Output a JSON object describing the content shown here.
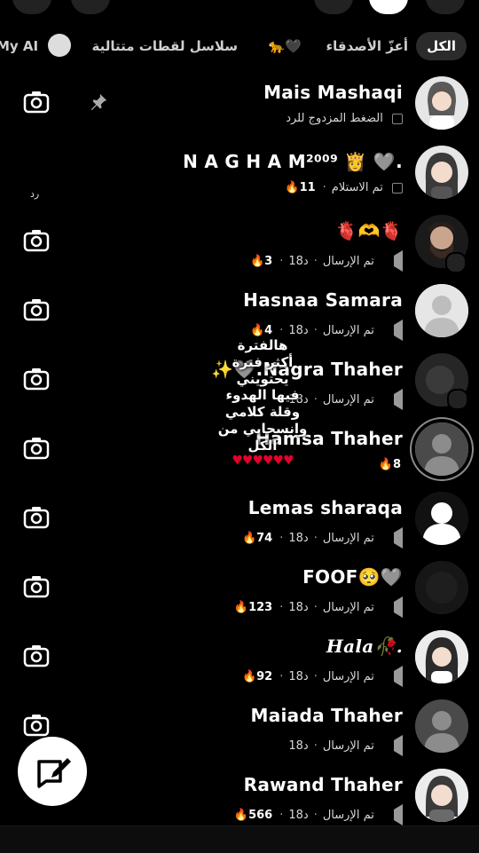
{
  "tabs": [
    {
      "label": "الكل",
      "active": true
    },
    {
      "label": "أعزّ الأصدقاء",
      "active": false
    },
    {
      "label": "🐆🖤",
      "active": false
    },
    {
      "label": "سلاسل لقطات متتالية",
      "active": false
    },
    {
      "label": "My AI",
      "active": false
    }
  ],
  "chats": [
    {
      "name": "Mais Mashaqi",
      "status": "الضغط المزدوج للرد",
      "status_icon": "checkbox",
      "time": "",
      "streak": "",
      "pinned": true
    },
    {
      "name": "N A G H A M²⁰⁰⁹ 👸 🩶.",
      "status": "تم الاستلام",
      "status_icon": "checkbox",
      "time": "",
      "streak": "11"
    },
    {
      "name": "🫀🫶🫀",
      "status": "تم الإرسال",
      "status_icon": "sent",
      "time": "18د",
      "streak": "3"
    },
    {
      "name": "Hasnaa Samara",
      "status": "تم الإرسال",
      "status_icon": "sent",
      "time": "18د",
      "streak": "4"
    },
    {
      "name": "✨🩶.Nagra Thaher",
      "status": "تم الإرسال",
      "status_icon": "sent",
      "time": "18د",
      "streak": ""
    },
    {
      "name": "Hamsa Thaher",
      "status": "",
      "status_icon": "",
      "time": "",
      "streak": "8"
    },
    {
      "name": "Lemas sharaqa",
      "status": "تم الإرسال",
      "status_icon": "sent",
      "time": "18د",
      "streak": "74"
    },
    {
      "name": "FOOF🥺🩶",
      "status": "تم الإرسال",
      "status_icon": "sent",
      "time": "18د",
      "streak": "123"
    },
    {
      "name": "Hala🥀.",
      "status": "تم الإرسال",
      "status_icon": "sent",
      "time": "18د",
      "streak": "92"
    },
    {
      "name": "Maiada Thaher",
      "status": "تم الإرسال",
      "status_icon": "sent",
      "time": "18د",
      "streak": ""
    },
    {
      "name": "Rawand Thaher",
      "status": "تم الإرسال",
      "status_icon": "sent",
      "time": "18د",
      "streak": "566"
    }
  ],
  "reply_hint": "رد",
  "overlay": {
    "line1": "هالفترة",
    "line2": "أكثر فترة يحتويني",
    "line3": "فيها الهدوء",
    "line4": "وقلة كلامي",
    "line5": "وانسحابي من الكل",
    "hearts": "♥♥♥♥♥♥"
  },
  "colors": {
    "background": "#000000",
    "streak": "#ffffff",
    "hearts": "#e4002b"
  }
}
